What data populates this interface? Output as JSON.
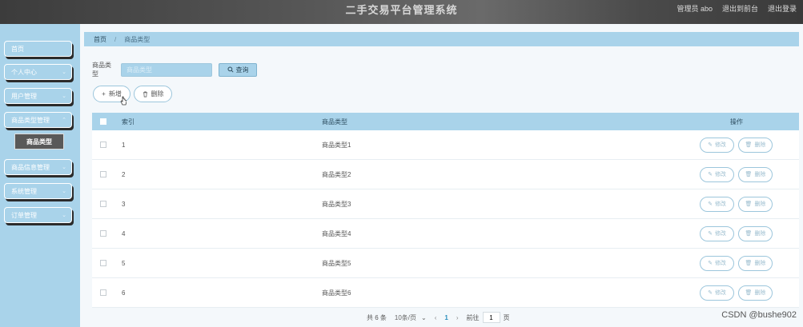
{
  "header": {
    "title": "二手交易平台管理系统",
    "user_label": "管理员 abo",
    "front_link": "退出到前台",
    "logout_link": "退出登录"
  },
  "sidebar": {
    "items": [
      {
        "label": "首页",
        "chevron": false
      },
      {
        "label": "个人中心",
        "chevron": true
      },
      {
        "label": "用户管理",
        "chevron": true
      },
      {
        "label": "商品类型管理",
        "chevron": true
      },
      {
        "label": "商品信息管理",
        "chevron": true
      },
      {
        "label": "系统管理",
        "chevron": true
      },
      {
        "label": "订单管理",
        "chevron": true
      }
    ],
    "active_sub": "商品类型"
  },
  "breadcrumb": {
    "home": "首页",
    "current": "商品类型"
  },
  "search": {
    "label": "商品类型",
    "placeholder": "商品类型",
    "button_label": "查询"
  },
  "actions": {
    "add_label": "新增",
    "delete_label": "删除"
  },
  "table": {
    "headers": {
      "index": "索引",
      "name": "商品类型",
      "ops": "操作"
    },
    "rows": [
      {
        "index": "1",
        "name": "商品类型1"
      },
      {
        "index": "2",
        "name": "商品类型2"
      },
      {
        "index": "3",
        "name": "商品类型3"
      },
      {
        "index": "4",
        "name": "商品类型4"
      },
      {
        "index": "5",
        "name": "商品类型5"
      },
      {
        "index": "6",
        "name": "商品类型6"
      }
    ],
    "edit_label": "修改",
    "delete_label": "删除"
  },
  "pagination": {
    "total": "共 6 条",
    "page_size": "10条/页",
    "current_page": "1",
    "goto_label": "前往",
    "goto_value": "1",
    "page_suffix": "页"
  },
  "watermark": "CSDN @bushe902",
  "colors": {
    "accent": "#a9d3ea",
    "header_bg": "#505050",
    "submenu_bg": "#595959"
  }
}
